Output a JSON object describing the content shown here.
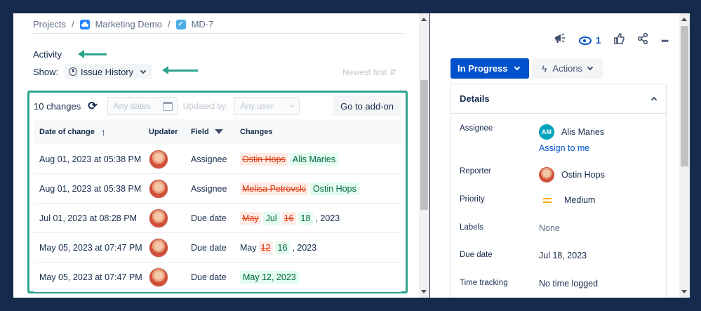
{
  "breadcrumb": {
    "projects": "Projects",
    "sep": "/",
    "project": "Marketing Demo",
    "issue": "MD-7",
    "task_check": "✓"
  },
  "activity": {
    "label": "Activity",
    "show_label": "Show:",
    "filter": "Issue History",
    "sort": "Newest first",
    "sort_icon": "⇵"
  },
  "addon": {
    "changes_count": "10 changes",
    "refresh_icon": "⟳",
    "dates_placeholder": "Any dates",
    "updated_by_label": "Updated by:",
    "user_placeholder": "Any user",
    "goto_label": "Go to add-on",
    "columns": {
      "date": "Date of change",
      "sort_icon": "↑",
      "updater": "Updater",
      "field": "Field",
      "changes": "Changes"
    },
    "rows": [
      {
        "date": "Aug 01, 2023 at 05:38 PM",
        "field": "Assignee",
        "changes": [
          {
            "t": "del",
            "v": "Ostin Hops"
          },
          {
            "t": "add",
            "v": "Alis Maries"
          }
        ]
      },
      {
        "date": "Aug 01, 2023 at 05:38 PM",
        "field": "Assignee",
        "changes": [
          {
            "t": "del",
            "v": "Melisa Petrovski"
          },
          {
            "t": "add",
            "v": "Ostin Hops"
          }
        ]
      },
      {
        "date": "Jul 01, 2023 at 08:28 PM",
        "field": "Due date",
        "changes": [
          {
            "t": "del",
            "v": "May"
          },
          {
            "t": "add",
            "v": "Jul"
          },
          {
            "t": "del",
            "v": "16"
          },
          {
            "t": "add",
            "v": "18"
          },
          {
            "t": "plain",
            "v": ", 2023"
          }
        ]
      },
      {
        "date": "May 05, 2023 at 07:47 PM",
        "field": "Due date",
        "changes": [
          {
            "t": "plain",
            "v": "May"
          },
          {
            "t": "del",
            "v": "12"
          },
          {
            "t": "add",
            "v": "16"
          },
          {
            "t": "plain",
            "v": ", 2023"
          }
        ]
      },
      {
        "date": "May 05, 2023 at 07:47 PM",
        "field": "Due date",
        "changes": [
          {
            "t": "add",
            "v": "May 12, 2023"
          }
        ]
      }
    ]
  },
  "issue": {
    "watchers": "1",
    "status": "In Progress",
    "actions": "Actions",
    "bolt_icon": "ϟ",
    "megaphone_icon": "📣",
    "like_icon": "👍",
    "share_icon": "⤴",
    "more_icon": "•••",
    "details": {
      "title": "Details",
      "assignee_label": "Assignee",
      "assignee_initials": "AM",
      "assignee": "Alis Maries",
      "assign_link": "Assign to me",
      "reporter_label": "Reporter",
      "reporter": "Ostin Hops",
      "priority_label": "Priority",
      "priority": "Medium",
      "labels_label": "Labels",
      "labels": "None",
      "due_label": "Due date",
      "due": "Jul 18, 2023",
      "tracking_label": "Time tracking",
      "tracking": "No time logged"
    }
  },
  "colors": {
    "accent": "#0052cc",
    "annotation": "#2da48c",
    "background": "#162a4e"
  }
}
